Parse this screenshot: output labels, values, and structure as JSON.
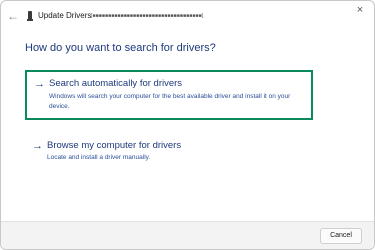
{
  "window": {
    "title": "Update Drivers",
    "device_name": "[■■■■■■■■■■■■■■■■■■■■■■■■■■■■■■■■■■■]",
    "close_glyph": "×",
    "back_glyph": "←"
  },
  "main": {
    "heading": "How do you want to search for drivers?",
    "options": [
      {
        "arrow": "→",
        "title": "Search automatically for drivers",
        "description": "Windows will search your computer for the best available driver and install it on your device.",
        "selected": true
      },
      {
        "arrow": "→",
        "title": "Browse my computer for drivers",
        "description": "Locate and install a driver manually.",
        "selected": false
      }
    ]
  },
  "footer": {
    "cancel_label": "Cancel"
  },
  "colors": {
    "accent_text": "#1d3a7c",
    "selection_border": "#0a8a5a",
    "footer_bg": "#f3f3f3"
  }
}
